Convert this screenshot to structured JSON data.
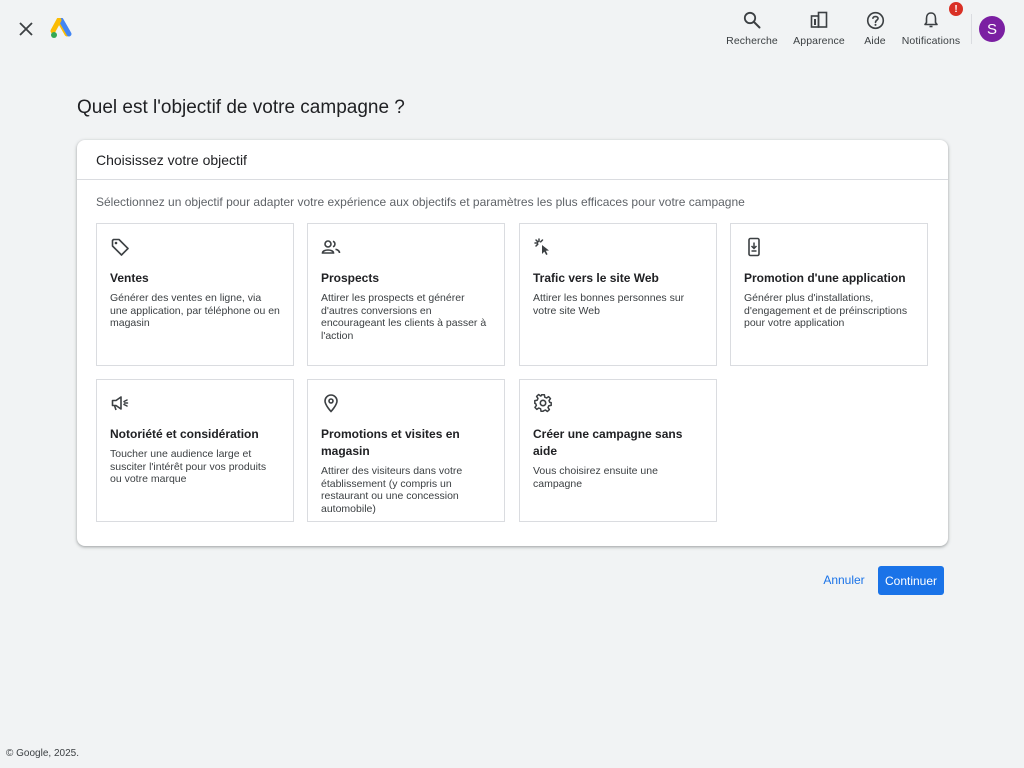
{
  "topbar": {
    "tools": [
      {
        "label": "Recherche",
        "icon": "search-icon"
      },
      {
        "label": "Apparence",
        "icon": "appearance-icon"
      },
      {
        "label": "Aide",
        "icon": "help-icon"
      },
      {
        "label": "Notifications",
        "icon": "bell-icon",
        "badge": "!"
      }
    ],
    "avatar_letter": "S"
  },
  "page": {
    "title": "Quel est l'objectif de votre campagne ?"
  },
  "card": {
    "header": "Choisissez votre objectif",
    "description": "Sélectionnez un objectif pour adapter votre expérience aux objectifs et paramètres les plus efficaces pour votre campagne",
    "objectives": [
      {
        "title": "Ventes",
        "desc": "Générer des ventes en ligne, via une application, par téléphone ou en magasin",
        "icon": "tag-icon"
      },
      {
        "title": "Prospects",
        "desc": "Attirer les prospects et générer d'autres conversions en encourageant les clients à passer à l'action",
        "icon": "people-icon"
      },
      {
        "title": "Trafic vers le site Web",
        "desc": "Attirer les bonnes personnes sur votre site Web",
        "icon": "cursor-click-icon"
      },
      {
        "title": "Promotion d'une application",
        "desc": "Générer plus d'installations, d'engagement et de préinscriptions pour votre application",
        "icon": "phone-download-icon"
      },
      {
        "title": "Notoriété et considération",
        "desc": "Toucher une audience large et susciter l'intérêt pour vos produits ou votre marque",
        "icon": "megaphone-icon"
      },
      {
        "title": "Promotions et visites en magasin",
        "desc": "Attirer des visiteurs dans votre établissement (y compris un restaurant ou une concession automobile)",
        "icon": "location-pin-icon"
      },
      {
        "title": "Créer une campagne sans aide",
        "desc": "Vous choisirez ensuite une campagne",
        "icon": "gear-icon"
      }
    ]
  },
  "actions": {
    "cancel": "Annuler",
    "continue": "Continuer"
  },
  "footer": "© Google, 2025.",
  "colors": {
    "accent": "#1a73e8",
    "avatar": "#7b1fa2",
    "badge": "#d93025",
    "background": "#f1f3f4"
  }
}
